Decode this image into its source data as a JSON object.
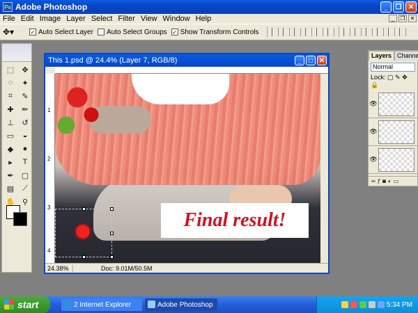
{
  "app": {
    "title": "Adobe Photoshop"
  },
  "menu": [
    "File",
    "Edit",
    "Image",
    "Layer",
    "Select",
    "Filter",
    "View",
    "Window",
    "Help"
  ],
  "options": {
    "auto_select_layer": "Auto Select Layer",
    "auto_select_groups": "Auto Select Groups",
    "show_transform_controls": "Show Transform Controls"
  },
  "document": {
    "title": "This 1.psd @ 24.4% (Layer 7, RGB/8)",
    "caption": "Final result!",
    "zoom": "24.38%",
    "doc_info": "Doc: 9.01M/50.5M",
    "ruler_marks": [
      "1",
      "2",
      "3",
      "4"
    ]
  },
  "layers_panel": {
    "tab_layers": "Layers",
    "tab_channels": "Channels",
    "blend_mode": "Normal",
    "lock_label": "Lock:"
  },
  "taskbar": {
    "start": "start",
    "ie_task": "2 Internet Explorer",
    "ps_task": "Adobe Photoshop",
    "clock": "5:34 PM"
  }
}
